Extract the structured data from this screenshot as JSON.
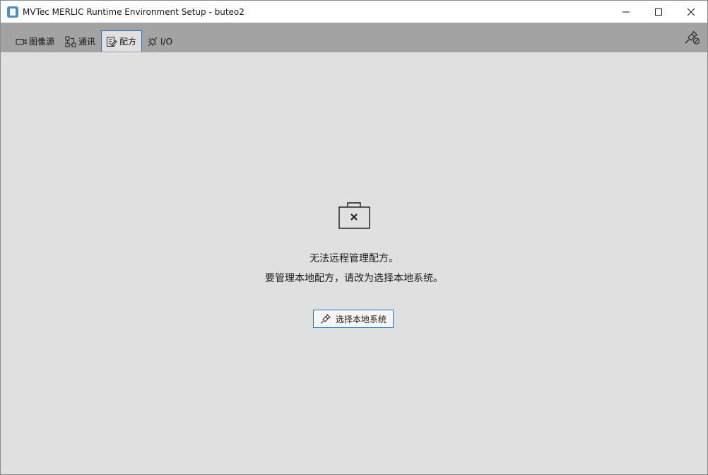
{
  "window": {
    "title": "MVTec MERLIC Runtime Environment Setup - buteo2"
  },
  "tabs": [
    {
      "label": "图像源",
      "icon": "camera-icon",
      "active": false
    },
    {
      "label": "通讯",
      "icon": "network-icon",
      "active": false
    },
    {
      "label": "配方",
      "icon": "recipe-icon",
      "active": true
    },
    {
      "label": "I/O",
      "icon": "io-plug-icon",
      "active": false
    }
  ],
  "toolbar": {
    "connection_icon": "connection-status-icon"
  },
  "main": {
    "status_icon": "recipe-unavailable-icon",
    "message_line1": "无法远程管理配方。",
    "message_line2": "要管理本地配方，请改为选择本地系统。",
    "select_local_button": "选择本地系统"
  },
  "colors": {
    "accent": "#1e78c8",
    "tabbar_bg": "#a3a3a3",
    "content_bg": "#e0e0e0"
  }
}
